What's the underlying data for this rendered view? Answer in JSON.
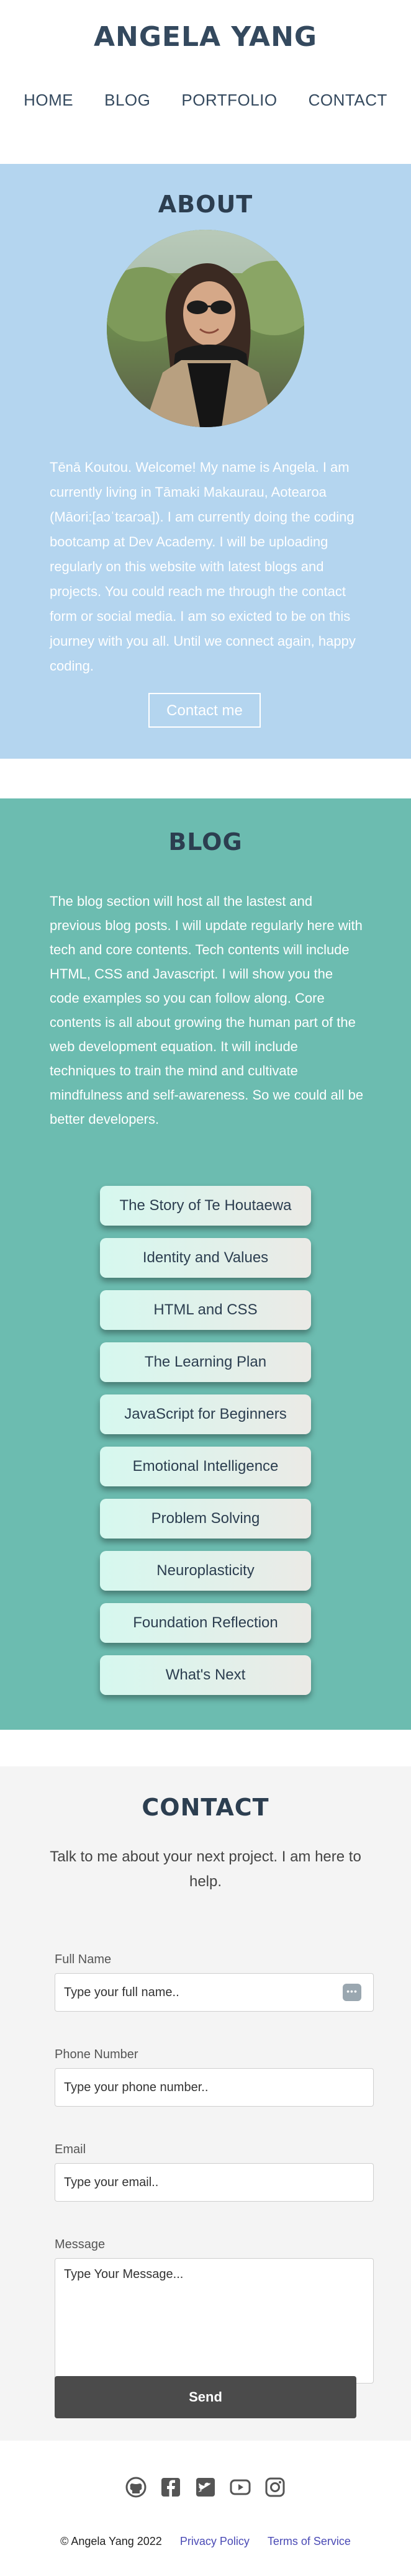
{
  "header": {
    "brand": "ANGELA YANG",
    "nav": [
      "HOME",
      "BLOG",
      "PORTFOLIO",
      "CONTACT"
    ]
  },
  "about": {
    "title": "ABOUT",
    "text": "Tēnā Koutou. Welcome! My name is Angela. I am currently living in Tāmaki Makaurau, Aotearoa (Māori:[aɔˈtɛaɾɔa]). I am currently doing the coding bootcamp at Dev Academy. I will be uploading regularly on this website with latest blogs and projects. You could reach me through the contact form or social media. I am so exicted to be on this journey with you all. Until we connect again, happy coding.",
    "button": "Contact me"
  },
  "blog": {
    "title": "BLOG",
    "text": "The blog section will host all the lastest and previous blog posts. I will update regularly here with tech and core contents. Tech contents will include HTML, CSS and Javascript. I will show you the code examples so you can follow along. Core contents is all about growing the human part of the web development equation. It will include techniques to train the mind and cultivate mindfulness and self-awareness. So we could all be better developers.",
    "posts": [
      "The Story of Te Houtaewa",
      "Identity and Values",
      "HTML and CSS",
      "The Learning Plan",
      "JavaScript for Beginners",
      "Emotional Intelligence",
      "Problem Solving",
      "Neuroplasticity",
      "Foundation Reflection",
      "What's Next"
    ]
  },
  "contact": {
    "title": "CONTACT",
    "subtitle": "Talk to me about your next project. I am here to help.",
    "fields": {
      "name_label": "Full Name",
      "name_placeholder": "Type your full name..",
      "phone_label": "Phone Number",
      "phone_placeholder": "Type your phone number..",
      "email_label": "Email",
      "email_placeholder": "Type your email..",
      "message_label": "Message",
      "message_placeholder": "Type Your Message..."
    },
    "send": "Send"
  },
  "footer": {
    "social_icons": [
      "github-icon",
      "facebook-icon",
      "twitter-icon",
      "youtube-icon",
      "instagram-icon"
    ],
    "copyright": "© Angela Yang 2022",
    "privacy": "Privacy Policy",
    "terms": "Terms of Service"
  }
}
